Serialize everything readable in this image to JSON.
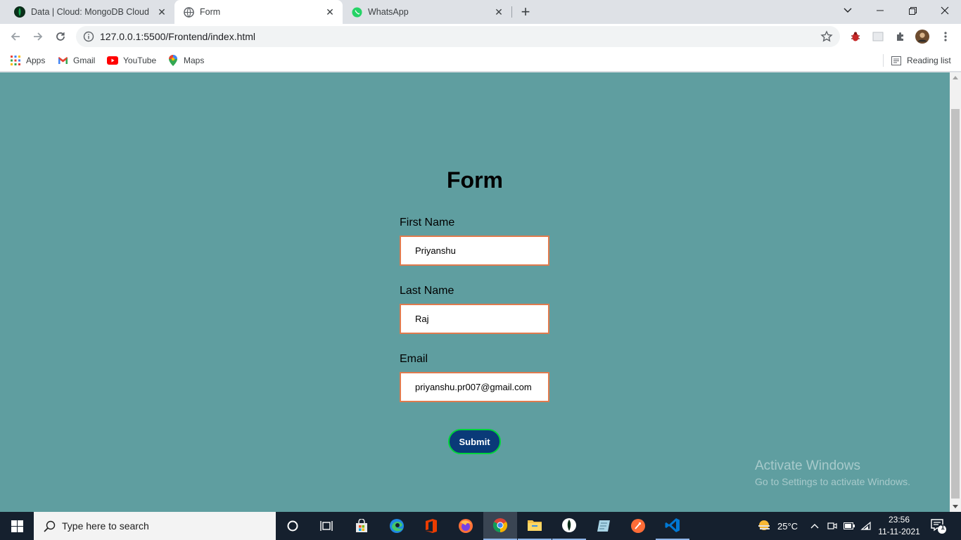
{
  "browser": {
    "tabs": [
      {
        "title": "Data | Cloud: MongoDB Cloud",
        "icon": "mongodb-leaf-icon",
        "active": false
      },
      {
        "title": "Form",
        "icon": "globe-icon",
        "active": true
      },
      {
        "title": "WhatsApp",
        "icon": "whatsapp-icon",
        "active": false
      }
    ],
    "url": "127.0.0.1:5500/Frontend/index.html",
    "bookmarks": [
      {
        "label": "Apps",
        "icon": "apps-grid-icon"
      },
      {
        "label": "Gmail",
        "icon": "gmail-icon"
      },
      {
        "label": "YouTube",
        "icon": "youtube-icon"
      },
      {
        "label": "Maps",
        "icon": "maps-pin-icon"
      }
    ],
    "reading_list": "Reading list"
  },
  "page": {
    "title": "Form",
    "fields": [
      {
        "label": "First Name",
        "value": "Priyanshu"
      },
      {
        "label": "Last Name",
        "value": "Raj"
      },
      {
        "label": "Email",
        "value": "priyanshu.pr007@gmail.com"
      }
    ],
    "submit_label": "Submit",
    "background_color": "#5f9ea0",
    "watermark": {
      "line1": "Activate Windows",
      "line2": "Go to Settings to activate Windows."
    }
  },
  "taskbar": {
    "search_placeholder": "Type here to search",
    "temperature": "25°C",
    "time": "23:56",
    "date": "11-11-2021",
    "notification_count": "1"
  }
}
